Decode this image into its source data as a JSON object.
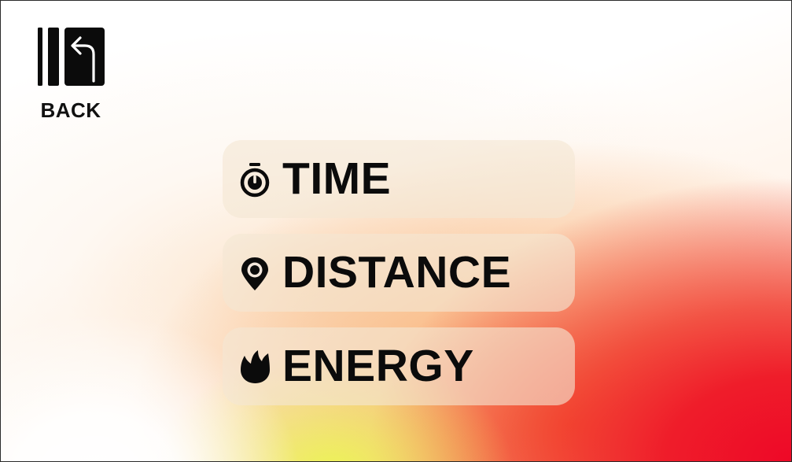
{
  "back": {
    "label": "BACK",
    "icon": "back-arrow-icon"
  },
  "menu": {
    "items": [
      {
        "label": "TIME",
        "icon": "stopwatch-icon"
      },
      {
        "label": "DISTANCE",
        "icon": "map-pin-icon"
      },
      {
        "label": "ENERGY",
        "icon": "flame-icon"
      }
    ]
  },
  "colors": {
    "text": "#0b0b0b",
    "button_bg": "#f4e6d4",
    "gradient_red": "#ee0827",
    "gradient_orange": "#f4762f",
    "gradient_yellow": "#ecf552"
  }
}
